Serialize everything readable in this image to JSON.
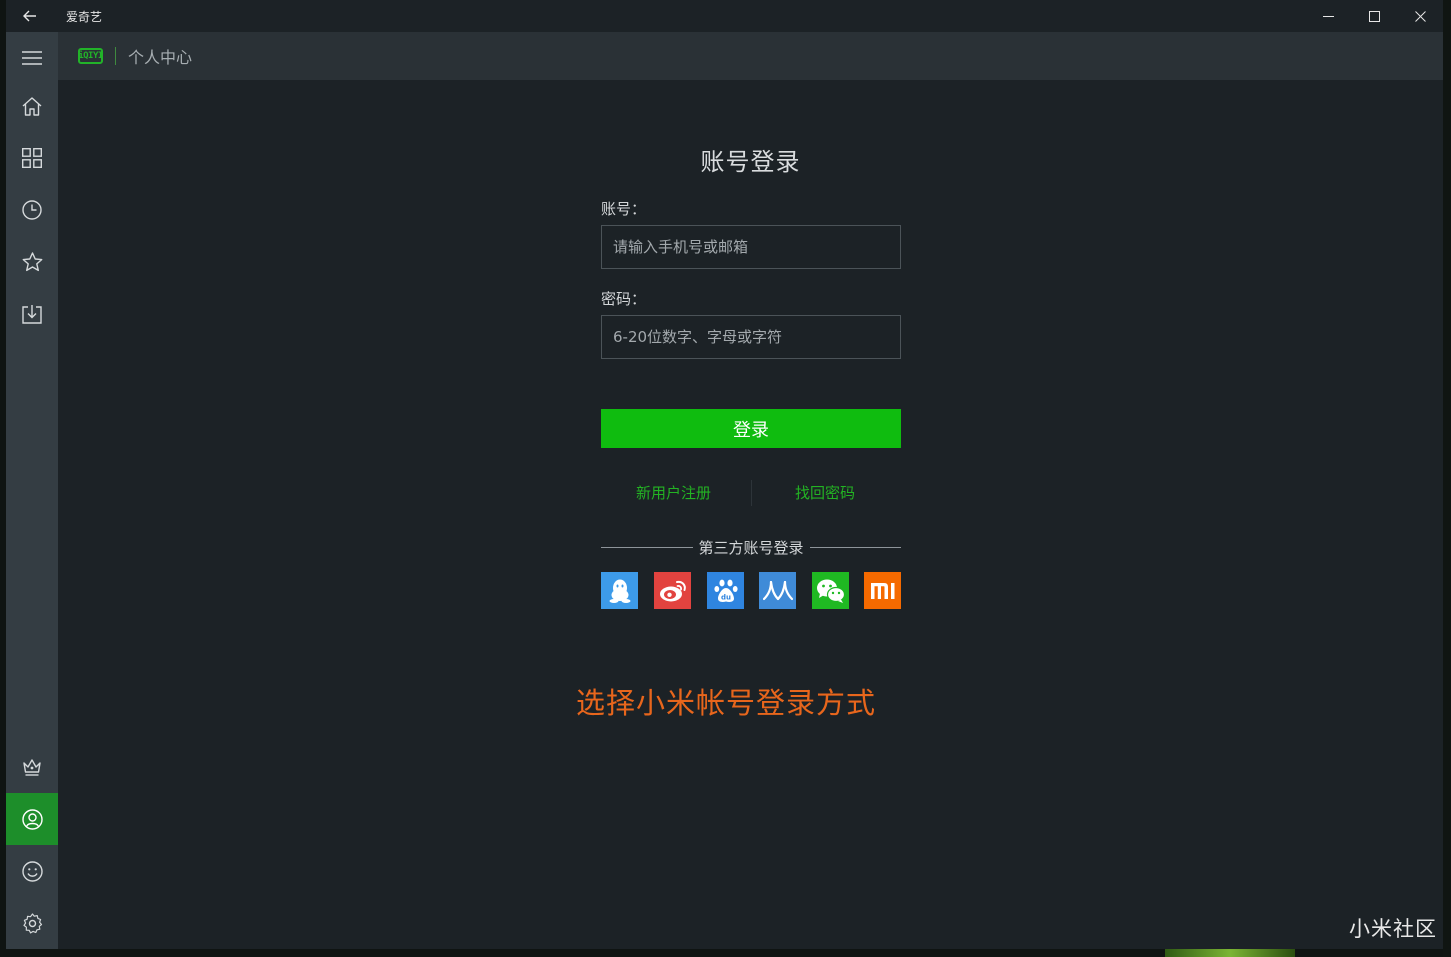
{
  "titlebar": {
    "app_title": "爱奇艺"
  },
  "header": {
    "logo_text": "iQIYI",
    "section_title": "个人中心"
  },
  "sidebar": {
    "items": [
      {
        "name": "menu",
        "icon": "hamburger-icon"
      },
      {
        "name": "home",
        "icon": "home-icon"
      },
      {
        "name": "categories",
        "icon": "grid-icon"
      },
      {
        "name": "history",
        "icon": "clock-icon"
      },
      {
        "name": "favorites",
        "icon": "star-icon"
      },
      {
        "name": "downloads",
        "icon": "download-icon"
      },
      {
        "name": "vip",
        "icon": "crown-icon"
      },
      {
        "name": "account",
        "icon": "user-icon",
        "active": true
      },
      {
        "name": "feedback",
        "icon": "smiley-icon"
      },
      {
        "name": "settings",
        "icon": "gear-icon"
      }
    ]
  },
  "login": {
    "title": "账号登录",
    "account_label": "账号：",
    "account_placeholder": "请输入手机号或邮箱",
    "password_label": "密码：",
    "password_placeholder": "6-20位数字、字母或字符",
    "submit_label": "登录",
    "register_link": "新用户注册",
    "recover_link": "找回密码",
    "third_party_title": "第三方账号登录",
    "third_party": [
      {
        "name": "qq",
        "icon": "qq-penguin-icon",
        "color": "#3d9be9"
      },
      {
        "name": "weibo",
        "icon": "weibo-icon",
        "color": "#e2433f"
      },
      {
        "name": "baidu",
        "icon": "baidu-paw-icon",
        "color": "#2f85e0"
      },
      {
        "name": "renren",
        "icon": "renren-icon",
        "color": "#3f8bd8"
      },
      {
        "name": "wechat",
        "icon": "wechat-icon",
        "color": "#1fb922"
      },
      {
        "name": "xiaomi",
        "icon": "xiaomi-mi-icon",
        "color": "#f56a00"
      }
    ]
  },
  "annotation": "选择小米帐号登录方式",
  "watermark": "小米社区",
  "colors": {
    "accent_green": "#0fbc0f",
    "link_green": "#23b323",
    "annotation_orange": "#e8661c",
    "sidebar_bg": "#343d43",
    "main_bg": "#1c2226"
  }
}
